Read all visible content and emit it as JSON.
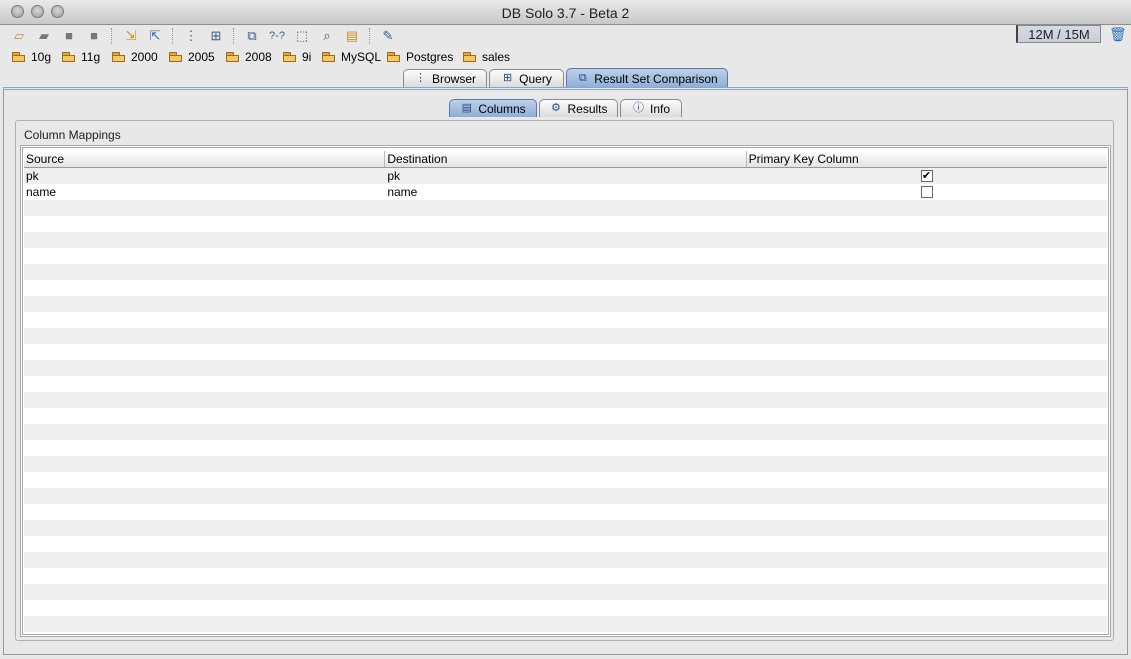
{
  "window": {
    "title": "DB Solo  3.7 - Beta 2"
  },
  "toolbar": {
    "icons": [
      "open-folder-icon",
      "gray-folder-icon",
      "save-icon",
      "save-all-icon",
      "import-icon",
      "export-icon",
      "tree-icon",
      "grid-icon",
      "compare-icon",
      "query-help-icon",
      "schema-icon",
      "search-icon",
      "clipboard-icon",
      "format-icon"
    ],
    "memory": "12M / 15M"
  },
  "bookmarks": [
    {
      "label": "10g"
    },
    {
      "label": "11g"
    },
    {
      "label": "2000"
    },
    {
      "label": "2005"
    },
    {
      "label": "2008"
    },
    {
      "label": "9i"
    },
    {
      "label": "MySQL"
    },
    {
      "label": "Postgres"
    },
    {
      "label": "sales"
    }
  ],
  "main_tabs": [
    {
      "label": "Browser",
      "icon": "tree-icon"
    },
    {
      "label": "Query",
      "icon": "grid-icon"
    },
    {
      "label": "Result Set Comparison",
      "icon": "compare-icon",
      "active": true
    }
  ],
  "sub_tabs": [
    {
      "label": "Columns",
      "icon": "columns-icon",
      "active": true
    },
    {
      "label": "Results",
      "icon": "results-icon"
    },
    {
      "label": "Info",
      "icon": "info-icon"
    }
  ],
  "column_mappings": {
    "group_label": "Column Mappings",
    "headers": [
      "Source",
      "Destination",
      "Primary Key Column"
    ],
    "rows": [
      {
        "source": "pk",
        "destination": "pk",
        "primary_key": true
      },
      {
        "source": "name",
        "destination": "name",
        "primary_key": false
      }
    ]
  },
  "colors": {
    "active_tab": "#9fbadf",
    "stripe": "#efefef"
  }
}
